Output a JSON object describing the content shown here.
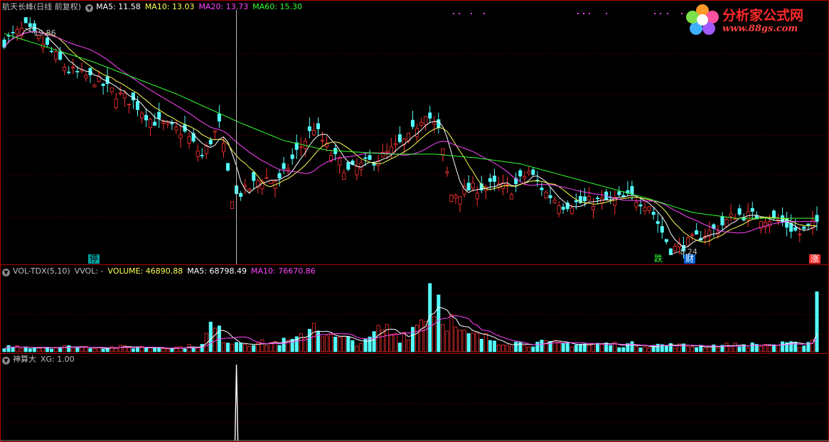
{
  "stock": {
    "name": "航天长峰",
    "period": "日线",
    "adjust": "前复权"
  },
  "ma_panel": {
    "title": "航天长峰(日线 前复权)",
    "items": [
      {
        "label": "MA5: 11.58",
        "color": "#ffffff"
      },
      {
        "label": "MA10: 13.03",
        "color": "#ffff55"
      },
      {
        "label": "MA20: 13.73",
        "color": "#ff44ff"
      },
      {
        "label": "MA60: 15.30",
        "color": "#33ff33"
      }
    ],
    "high_label": "19.86",
    "low_label": "8.24"
  },
  "vol_panel": {
    "title": "VOL-TDX(5,10)",
    "items": [
      {
        "label": "VVOL: -",
        "color": "#c0c0c0"
      },
      {
        "label": "VOLUME: 46890.88",
        "color": "#ffff55"
      },
      {
        "label": "MA5: 68798.49",
        "color": "#ffffff"
      },
      {
        "label": "MA10: 76670.86",
        "color": "#ff44ff"
      }
    ]
  },
  "xg_panel": {
    "title": "神算大",
    "items": [
      {
        "label": "XG: 1.00",
        "color": "#c0c0c0"
      }
    ]
  },
  "markers": {
    "ting": "停",
    "die": "跌",
    "cai": "财",
    "zhang": "涨"
  },
  "logo": {
    "title": "分析家公式网",
    "url": "www.88gs.com"
  },
  "chart_data": {
    "type": "line",
    "title": "航天长峰(日线 前复权)",
    "ma_values": {
      "MA5": 11.58,
      "MA10": 13.03,
      "MA20": 13.73,
      "MA60": 15.3
    },
    "price_high": 19.86,
    "price_low": 8.24,
    "ylim": [
      7.8,
      20.6
    ],
    "n_bars": 190,
    "key_points": [
      [
        0,
        19.2
      ],
      [
        5,
        19.9
      ],
      [
        10,
        18.9
      ],
      [
        15,
        17.7
      ],
      [
        18,
        17.5
      ],
      [
        22,
        17.1
      ],
      [
        26,
        16.5
      ],
      [
        30,
        16.1
      ],
      [
        34,
        15.2
      ],
      [
        38,
        14.8
      ],
      [
        42,
        14.5
      ],
      [
        46,
        13.3
      ],
      [
        50,
        14.9
      ],
      [
        53,
        11.2
      ],
      [
        56,
        11.5
      ],
      [
        60,
        12.2
      ],
      [
        64,
        12.0
      ],
      [
        68,
        13.5
      ],
      [
        72,
        14.8
      ],
      [
        76,
        13.4
      ],
      [
        80,
        12.5
      ],
      [
        84,
        12.9
      ],
      [
        88,
        13.3
      ],
      [
        94,
        14.2
      ],
      [
        98,
        15.6
      ],
      [
        101,
        14.6
      ],
      [
        104,
        11.3
      ],
      [
        108,
        11.6
      ],
      [
        114,
        11.8
      ],
      [
        118,
        11.6
      ],
      [
        122,
        12.5
      ],
      [
        126,
        11.4
      ],
      [
        130,
        10.8
      ],
      [
        134,
        10.9
      ],
      [
        140,
        11.0
      ],
      [
        146,
        11.2
      ],
      [
        150,
        10.8
      ],
      [
        153,
        9.4
      ],
      [
        155,
        8.5
      ],
      [
        158,
        8.7
      ],
      [
        162,
        9.2
      ],
      [
        166,
        9.6
      ],
      [
        170,
        10.3
      ],
      [
        175,
        10.2
      ],
      [
        180,
        10.0
      ],
      [
        185,
        9.3
      ],
      [
        189,
        9.9
      ]
    ],
    "ma60_points": [
      [
        0,
        19.6
      ],
      [
        20,
        18.2
      ],
      [
        40,
        16.5
      ],
      [
        55,
        15.0
      ],
      [
        65,
        14.1
      ],
      [
        75,
        13.6
      ],
      [
        90,
        13.4
      ],
      [
        100,
        13.4
      ],
      [
        110,
        13.2
      ],
      [
        120,
        12.9
      ],
      [
        140,
        11.7
      ],
      [
        150,
        11.1
      ],
      [
        160,
        10.4
      ],
      [
        170,
        10.1
      ],
      [
        189,
        10.1
      ]
    ],
    "vol_ylim": [
      0,
      250000
    ],
    "vol_key_points": [
      [
        0,
        18000
      ],
      [
        40,
        15000
      ],
      [
        46,
        22000
      ],
      [
        48,
        90000
      ],
      [
        52,
        40000
      ],
      [
        60,
        30000
      ],
      [
        68,
        38000
      ],
      [
        72,
        105000
      ],
      [
        76,
        48000
      ],
      [
        84,
        32000
      ],
      [
        88,
        85000
      ],
      [
        92,
        55000
      ],
      [
        96,
        95000
      ],
      [
        99,
        185000
      ],
      [
        102,
        150000
      ],
      [
        106,
        60000
      ],
      [
        120,
        30000
      ],
      [
        150,
        24000
      ],
      [
        160,
        20000
      ],
      [
        186,
        26000
      ],
      [
        189,
        46890
      ]
    ],
    "xg_signal_bar": 54,
    "xg_value": 1.0
  }
}
